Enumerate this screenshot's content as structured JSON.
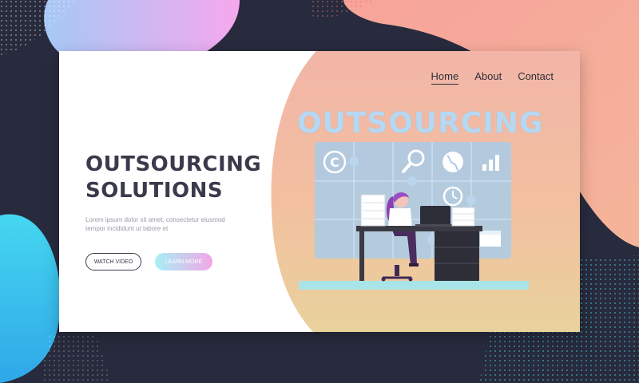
{
  "nav": {
    "items": [
      {
        "label": "Home",
        "active": true
      },
      {
        "label": "About",
        "active": false
      },
      {
        "label": "Contact",
        "active": false
      }
    ]
  },
  "hero": {
    "headline_line1": "OUTSOURCING",
    "headline_line2": "SOLUTIONS",
    "body": "Lorem ipsum dolor sit amet, consectetur eiusmod tempor incididunt ut labore et",
    "watch_button": "WATCH VIDEO",
    "learn_button": "LEARN MORE"
  },
  "illustration": {
    "title": "OUTSOURCING",
    "icons": [
      "copyright-icon",
      "magnifier-icon",
      "globe-icon",
      "bar-chart-icon",
      "clock-icon",
      "calendar-icon"
    ]
  },
  "colors": {
    "background": "#272b3d",
    "card": "#ffffff",
    "text_dark": "#3a3a4c",
    "text_muted": "#9a9aa8",
    "accent_cyan": "#a6f0f5",
    "accent_pink": "#f2a6e6"
  }
}
